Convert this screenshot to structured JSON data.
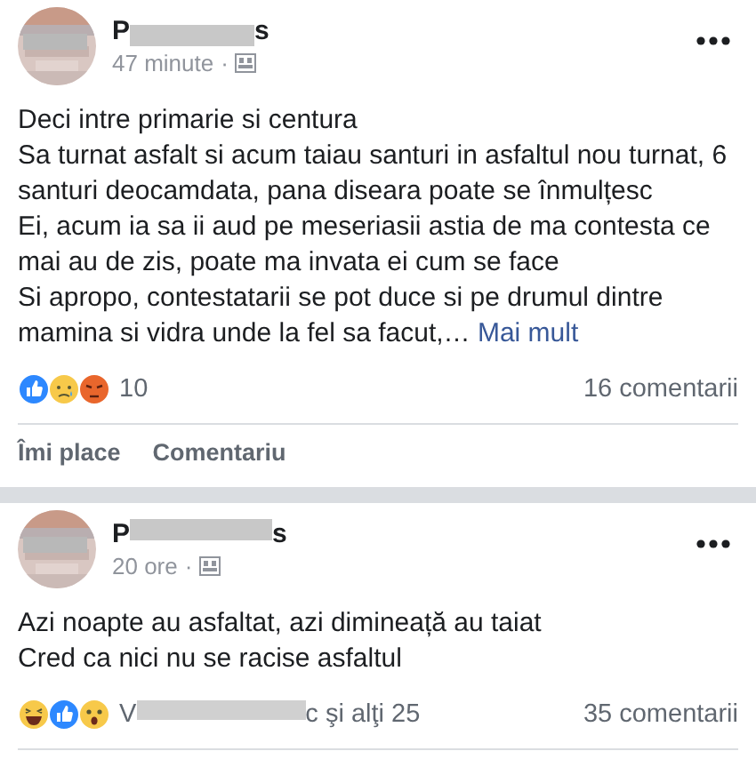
{
  "posts": [
    {
      "author_parts": [
        "P",
        "s"
      ],
      "time": "47 minute",
      "time_separator": "·",
      "paragraphs": [
        "Deci intre primarie si centura",
        "Sa turnat asfalt si acum taiau santuri in asfaltul nou turnat, 6 santuri deocamdata, pana diseara poate se înmulțesc",
        "Ei, acum ia sa ii aud pe meseriasii astia de ma contesta ce mai au de zis, poate ma invata ei cum se face",
        "Si apropo, contestatarii se pot duce si pe drumul dintre mamina si vidra unde la fel sa facut,…"
      ],
      "more_link": "Mai mult",
      "reactions": [
        {
          "kind": "like"
        },
        {
          "kind": "sad"
        },
        {
          "kind": "angry"
        }
      ],
      "reaction_parts": [
        "10"
      ],
      "comments": "16 comentarii",
      "actions": [
        "Îmi place",
        "Comentariu"
      ]
    },
    {
      "author_parts": [
        "P",
        "s"
      ],
      "time": "20 ore",
      "time_separator": "·",
      "paragraphs": [
        "Azi noapte au asfaltat, azi dimineață au taiat",
        "Cred ca nici nu se racise asfaltul"
      ],
      "reactions": [
        {
          "kind": "haha"
        },
        {
          "kind": "like"
        },
        {
          "kind": "wow"
        }
      ],
      "reaction_parts": [
        "V",
        "c şi alţi 25"
      ],
      "comments": "35 comentarii"
    }
  ]
}
